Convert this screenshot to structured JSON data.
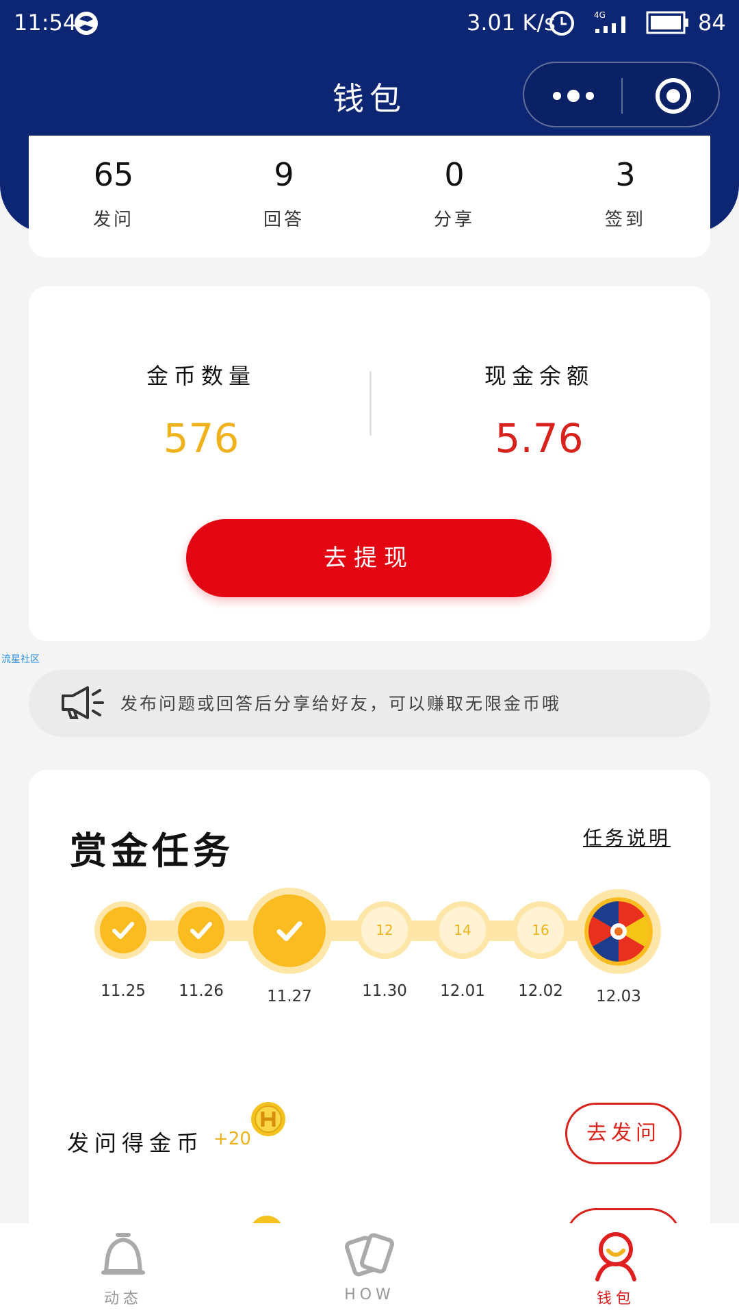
{
  "status_bar": {
    "time": "11:54",
    "speed": "3.01 K/s",
    "network": "4G",
    "battery": "84"
  },
  "nav": {
    "title": "钱包",
    "more_icon": "more-dots-icon",
    "target_icon": "target-icon"
  },
  "stats": [
    {
      "value": "65",
      "label": "发问"
    },
    {
      "value": "9",
      "label": "回答"
    },
    {
      "value": "0",
      "label": "分享"
    },
    {
      "value": "3",
      "label": "签到"
    }
  ],
  "wallet": {
    "coins_label": "金币数量",
    "coins_value": "576",
    "cash_label": "现金余额",
    "cash_value": "5.76",
    "withdraw_label": "去提现"
  },
  "community_label": "流星社区",
  "notice": {
    "text": "发布问题或回答后分享给好友，可以赚取无限金币哦"
  },
  "tasks": {
    "title": "赏金任务",
    "explain_label": "任务说明",
    "days": [
      {
        "date": "11.25",
        "state": "done",
        "reward": ""
      },
      {
        "date": "11.26",
        "state": "done",
        "reward": ""
      },
      {
        "date": "11.27",
        "state": "today",
        "reward": ""
      },
      {
        "date": "11.30",
        "state": "pending",
        "reward": "12"
      },
      {
        "date": "12.01",
        "state": "pending",
        "reward": "14"
      },
      {
        "date": "12.02",
        "state": "pending",
        "reward": "16"
      },
      {
        "date": "12.03",
        "state": "wheel",
        "reward": ""
      }
    ],
    "reward_row": {
      "label": "发问得金币",
      "amount": "+20",
      "button": "去发问"
    }
  },
  "tabbar": [
    {
      "label": "动态",
      "icon": "bell-icon",
      "active": false
    },
    {
      "label": "HOW",
      "icon": "cards-icon",
      "active": false
    },
    {
      "label": "钱包",
      "icon": "wallet-person-icon",
      "active": true
    }
  ],
  "colors": {
    "header": "#0d2673",
    "coins": "#f0b21c",
    "cash": "#d8231d",
    "withdraw": "#e30612",
    "active_tab": "#e02020"
  }
}
